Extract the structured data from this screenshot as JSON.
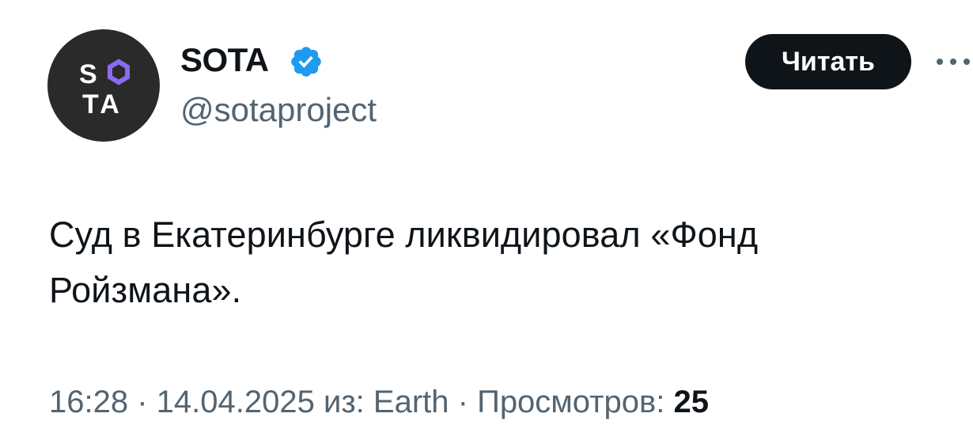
{
  "author": {
    "avatar_text_top_left": "S",
    "avatar_text_bottom": "TA",
    "display_name": "SOTA",
    "handle": "@sotaproject",
    "verified": true
  },
  "follow_button_label": "Читать",
  "more_icon": "more-horizontal-icon",
  "tweet_text": "Суд в Екатеринбурге ликвидировал «Фонд Ройзмана».",
  "meta": {
    "time": "16:28",
    "separator": " · ",
    "date": "14.04.2025",
    "source_prefix": "из: ",
    "source": "Earth",
    "views_label": "Просмотров: ",
    "views_count": "25"
  },
  "colors": {
    "text": "#0f1419",
    "secondary": "#536471",
    "verified": "#1d9bf0",
    "avatar_bg": "#2a2a2a",
    "logo_accent": "#8b6cf0",
    "button_bg": "#0f1419"
  }
}
